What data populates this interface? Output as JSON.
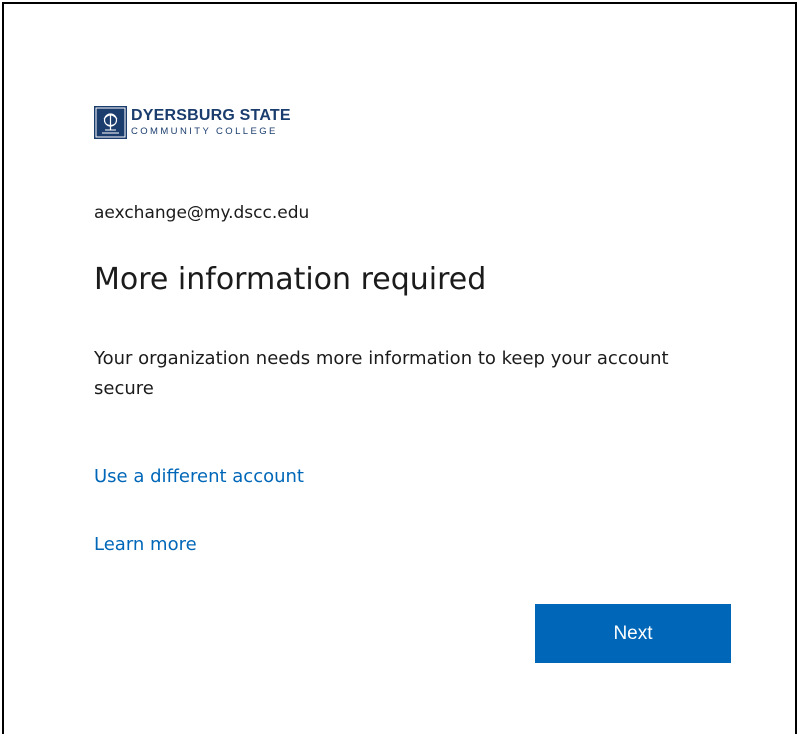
{
  "logo": {
    "line1": "DYERSBURG STATE",
    "line2": "COMMUNITY COLLEGE"
  },
  "account": {
    "email": "aexchange@my.dscc.edu"
  },
  "main": {
    "title": "More information required",
    "description": "Your organization needs more information to keep your account secure"
  },
  "links": {
    "different_account": "Use a different account",
    "learn_more": "Learn more"
  },
  "actions": {
    "next_label": "Next"
  },
  "colors": {
    "accent": "#0067b8",
    "brand": "#1b3d6e",
    "text": "#1b1b1b"
  }
}
